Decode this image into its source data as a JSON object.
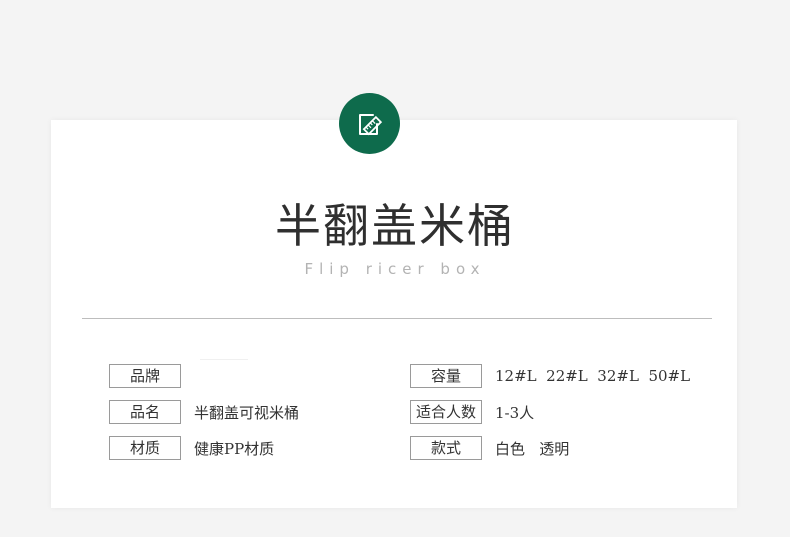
{
  "header": {
    "badge_icon": "pencil-ruler-icon",
    "badge_color": "#0e6b4c",
    "title": "半翻盖米桶",
    "subtitle": "Flip ricer box"
  },
  "specs": {
    "left": [
      {
        "label": "品牌",
        "value": ""
      },
      {
        "label": "品名",
        "value": "半翻盖可视米桶"
      },
      {
        "label": "材质",
        "value": "健康PP材质"
      }
    ],
    "right": [
      {
        "label": "容量",
        "value": "12#L  22#L  32#L  50#L"
      },
      {
        "label": "适合人数",
        "value": "1-3人"
      },
      {
        "label": "款式",
        "value": "白色   透明"
      }
    ]
  }
}
